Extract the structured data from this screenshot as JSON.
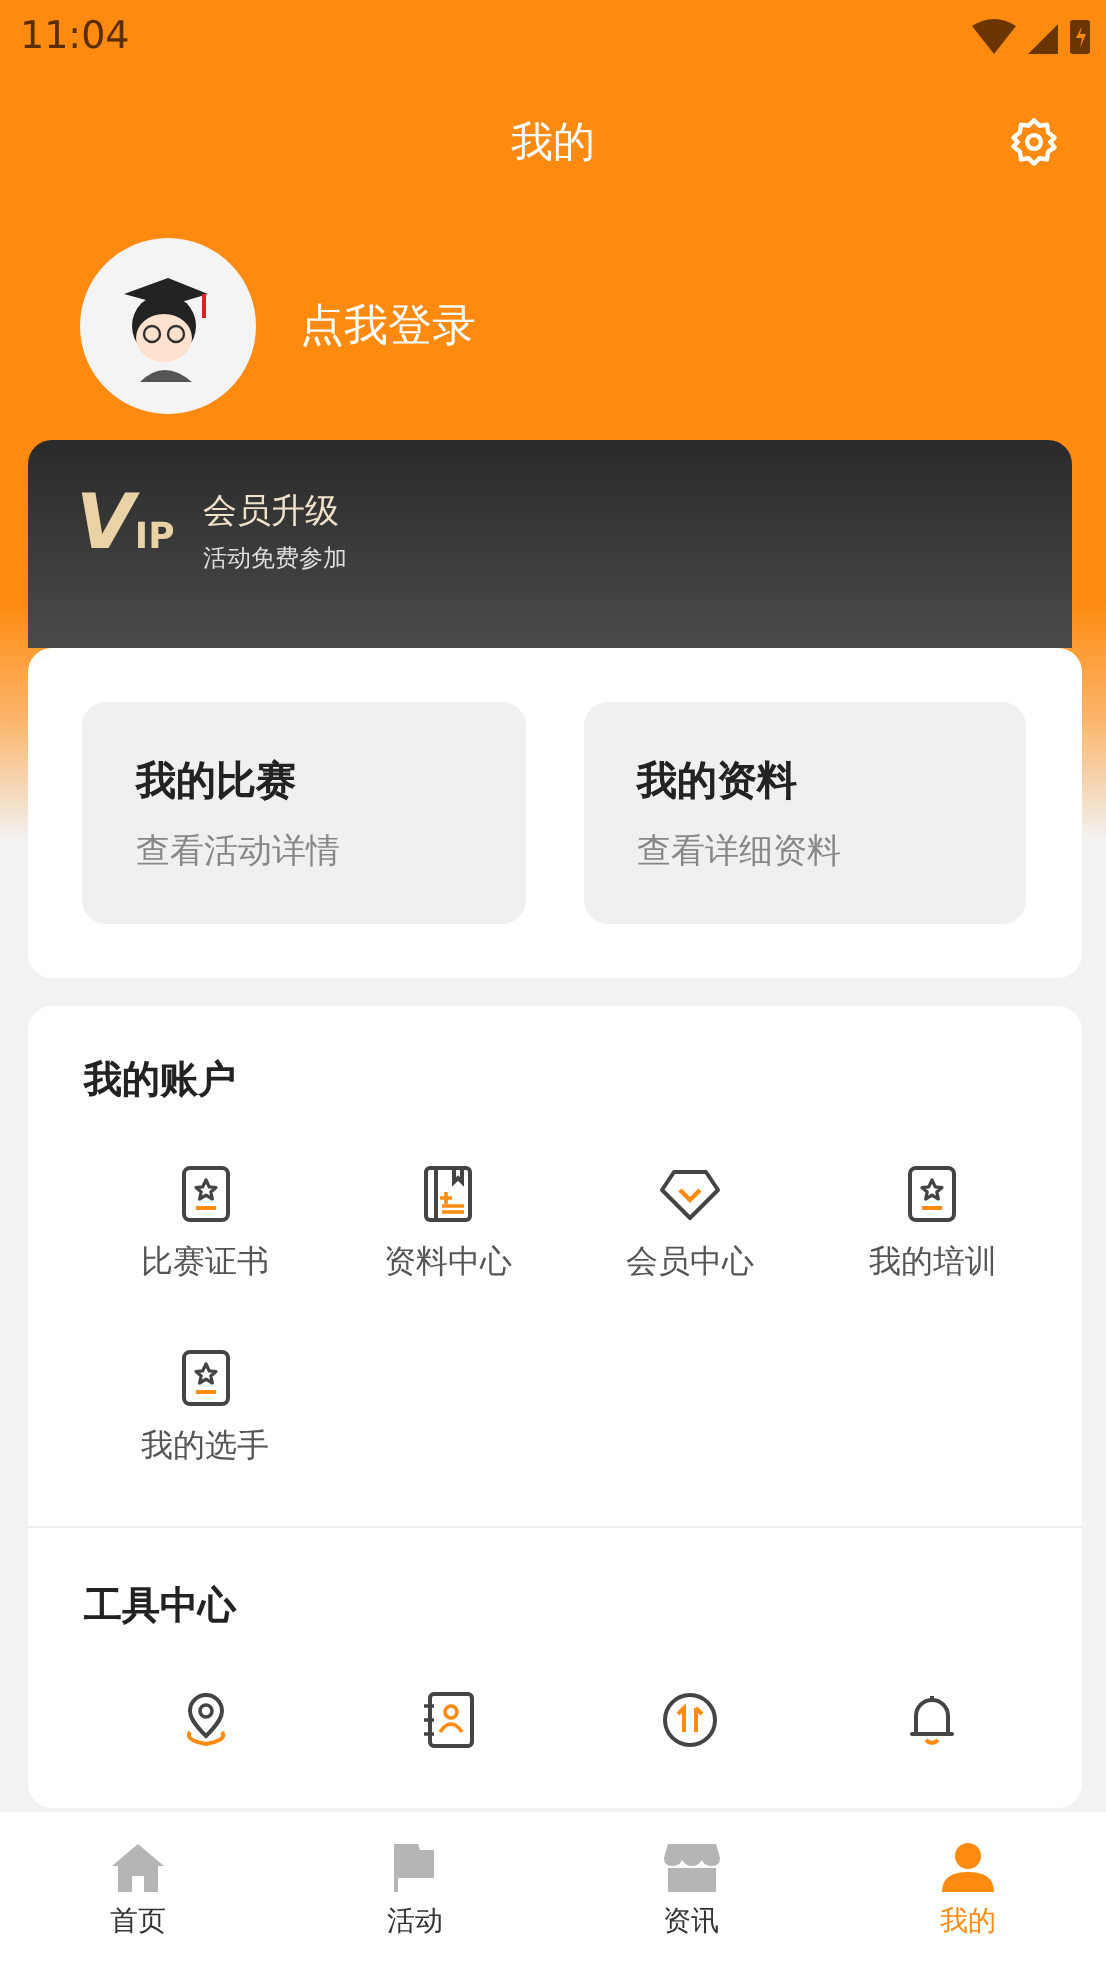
{
  "status_bar": {
    "time": "11:04"
  },
  "header": {
    "title": "我的"
  },
  "profile": {
    "login_text": "点我登录"
  },
  "vip": {
    "title": "会员升级",
    "subtitle": "活动免费参加",
    "logo_v": "V",
    "logo_ip": "IP"
  },
  "quick_cards": [
    {
      "title": "我的比赛",
      "subtitle": "查看活动详情"
    },
    {
      "title": "我的资料",
      "subtitle": "查看详细资料"
    }
  ],
  "account": {
    "title": "我的账户",
    "items": [
      {
        "label": "比赛证书",
        "kind": "certificate"
      },
      {
        "label": "资料中心",
        "kind": "book"
      },
      {
        "label": "会员中心",
        "kind": "diamond"
      },
      {
        "label": "我的培训",
        "kind": "certificate"
      },
      {
        "label": "我的选手",
        "kind": "certificate"
      }
    ]
  },
  "tools": {
    "title": "工具中心",
    "items": [
      {
        "kind": "location"
      },
      {
        "kind": "contacts"
      },
      {
        "kind": "update"
      },
      {
        "kind": "bell"
      }
    ]
  },
  "bottom_nav": [
    {
      "label": "首页",
      "kind": "home",
      "selected": false
    },
    {
      "label": "活动",
      "kind": "flag",
      "selected": false
    },
    {
      "label": "资讯",
      "kind": "store",
      "selected": false
    },
    {
      "label": "我的",
      "kind": "person",
      "selected": true
    }
  ]
}
